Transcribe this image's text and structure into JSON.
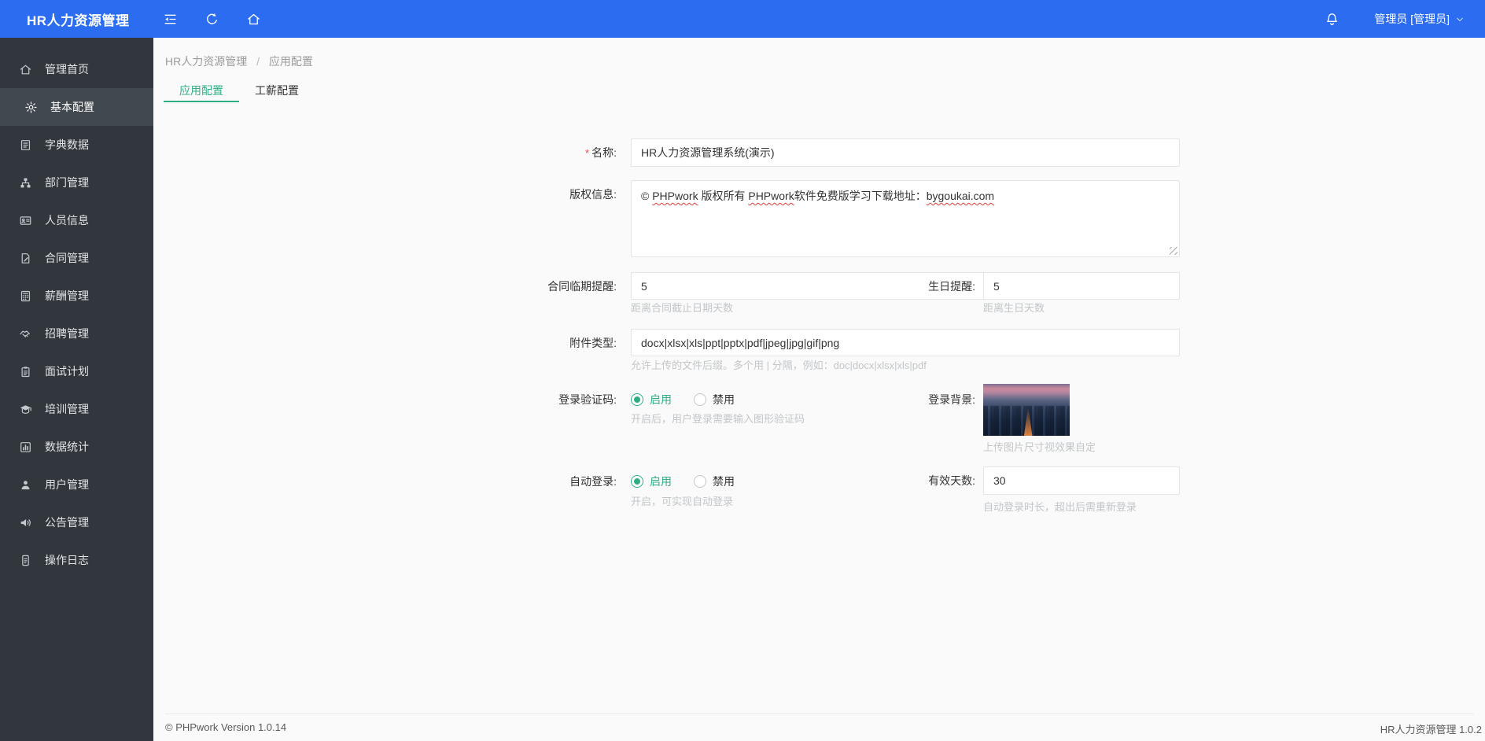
{
  "topbar": {
    "title": "HR人力资源管理",
    "icons": [
      "menu-fold-icon",
      "refresh-icon",
      "home-icon"
    ],
    "bell_icon": "bell-icon",
    "user": "管理员 [管理员]"
  },
  "sidebar": {
    "items": [
      {
        "id": "home",
        "icon": "home-icon",
        "label": "管理首页",
        "active": false
      },
      {
        "id": "basic-config",
        "icon": "gear-icon",
        "label": "基本配置",
        "active": true
      },
      {
        "id": "dict-data",
        "icon": "dict-icon",
        "label": "字典数据",
        "active": false
      },
      {
        "id": "department",
        "icon": "org-icon",
        "label": "部门管理",
        "active": false
      },
      {
        "id": "staff-info",
        "icon": "idcard-icon",
        "label": "人员信息",
        "active": false
      },
      {
        "id": "contract",
        "icon": "contract-icon",
        "label": "合同管理",
        "active": false
      },
      {
        "id": "salary",
        "icon": "salary-icon",
        "label": "薪酬管理",
        "active": false
      },
      {
        "id": "recruit",
        "icon": "recruit-icon",
        "label": "招聘管理",
        "active": false
      },
      {
        "id": "interview",
        "icon": "interview-icon",
        "label": "面试计划",
        "active": false
      },
      {
        "id": "training",
        "icon": "training-icon",
        "label": "培训管理",
        "active": false
      },
      {
        "id": "stats",
        "icon": "stats-icon",
        "label": "数据统计",
        "active": false
      },
      {
        "id": "users",
        "icon": "user-icon",
        "label": "用户管理",
        "active": false
      },
      {
        "id": "announce",
        "icon": "announce-icon",
        "label": "公告管理",
        "active": false
      },
      {
        "id": "logs",
        "icon": "log-icon",
        "label": "操作日志",
        "active": false
      }
    ]
  },
  "breadcrumb": {
    "root": "HR人力资源管理",
    "separator": "/",
    "current": "应用配置"
  },
  "tabs": [
    {
      "label": "应用配置",
      "active": true
    },
    {
      "label": "工薪配置",
      "active": false
    }
  ],
  "form": {
    "name": {
      "label": "名称:",
      "required_mark": "*",
      "value": "HR人力资源管理系统(演示)"
    },
    "copyright": {
      "label": "版权信息:",
      "segments": [
        {
          "text": "© ",
          "wavy": false
        },
        {
          "text": "PHPwork",
          "wavy": true
        },
        {
          "text": " 版权所有 ",
          "wavy": false
        },
        {
          "text": "PHPwork",
          "wavy": true
        },
        {
          "text": "软件免费版学习下载地址：",
          "wavy": false
        },
        {
          "text": "bygoukai.com",
          "wavy": true
        }
      ]
    },
    "contract_reminder": {
      "label": "合同临期提醒:",
      "value": "5",
      "hint": "距离合同截止日期天数"
    },
    "birthday_reminder": {
      "label": "生日提醒:",
      "value": "5",
      "hint": "距离生日天数"
    },
    "attachment_types": {
      "label": "附件类型:",
      "value": "docx|xlsx|xls|ppt|pptx|pdf|jpeg|jpg|gif|png",
      "hint": "允许上传的文件后缀。多个用 | 分隔，例如：doc|docx|xlsx|xls|pdf"
    },
    "login_captcha": {
      "label": "登录验证码:",
      "options": [
        "启用",
        "禁用"
      ],
      "selected": "启用",
      "hint": "开启后，用户登录需要输入图形验证码"
    },
    "login_background": {
      "label": "登录背景:",
      "image": "city-skyline-at-dusk-thumbnail",
      "hint": "上传图片尺寸视效果自定"
    },
    "auto_login": {
      "label": "自动登录:",
      "options": [
        "启用",
        "禁用"
      ],
      "selected": "启用",
      "hint": "开启，可实现自动登录"
    },
    "valid_days": {
      "label": "有效天数:",
      "value": "30",
      "hint": "自动登录时长，超出后需重新登录"
    }
  },
  "footer": {
    "left": "© PHPwork Version 1.0.14",
    "right": "HR人力资源管理 1.0.2"
  },
  "colors": {
    "topbar_blue": "#2b6cf0",
    "sidebar_dark": "#32373e",
    "sidebar_active": "#42484f",
    "accent_green": "#2fae85",
    "hint_gray": "#c2c6c9",
    "required_red": "#f04b4b"
  }
}
